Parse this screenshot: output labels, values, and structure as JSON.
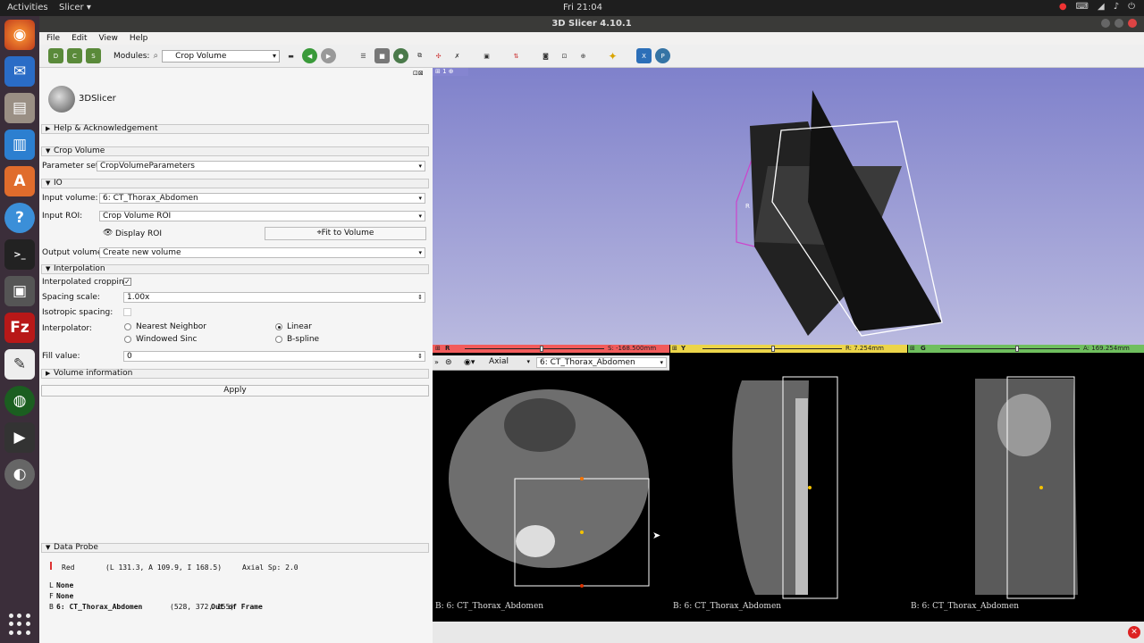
{
  "topbar": {
    "activities": "Activities",
    "app": "Slicer ▾",
    "clock": "Fri 21:04"
  },
  "window_title": "3D Slicer 4.10.1",
  "menu": [
    "File",
    "Edit",
    "View",
    "Help"
  ],
  "toolbar": {
    "modules_label": "Modules:",
    "module_selected": "Crop Volume"
  },
  "logo": "3DSlicer",
  "sections": {
    "help": "Help & Acknowledgement",
    "crop": "Crop Volume",
    "io": "IO",
    "interpolation": "Interpolation",
    "volinfo": "Volume information",
    "probe": "Data Probe"
  },
  "form": {
    "param_label": "Parameter set:",
    "param_value": "CropVolumeParameters",
    "input_vol_label": "Input volume:",
    "input_vol_value": "6: CT_Thorax_Abdomen",
    "input_roi_label": "Input ROI:",
    "input_roi_value": "Crop Volume ROI",
    "display_roi": "Display ROI",
    "fit_button": "Fit to Volume",
    "output_label": "Output volume:",
    "output_value": "Create new volume",
    "interp_crop_label": "Interpolated cropping:",
    "spacing_label": "Spacing scale:",
    "spacing_value": "1.00x",
    "iso_label": "Isotropic spacing:",
    "interpolator_label": "Interpolator:",
    "opt_nn": "Nearest Neighbor",
    "opt_linear": "Linear",
    "opt_ws": "Windowed Sinc",
    "opt_bs": "B-spline",
    "fill_label": "Fill value:",
    "fill_value": "0",
    "apply": "Apply"
  },
  "probe": {
    "red": "Red",
    "coords": "(L 131.3, A 109.9, I 168.5)",
    "axial": "Axial Sp: 2.0",
    "l_prefix": "L",
    "l_value": "None",
    "f_prefix": "F",
    "f_value": "None",
    "b_prefix": "B",
    "b_name": "6: CT_Thorax_Abdomen",
    "b_ijk": "(528, 372, 155)",
    "b_state": "Out of Frame"
  },
  "view3d": {
    "number": "1",
    "roi_label": "R"
  },
  "slices": {
    "red": {
      "letter": "R",
      "offset": "S: -168.500mm",
      "orientation": "Axial",
      "volume": "6: CT_Thorax_Abdomen",
      "caption": "B: 6: CT_Thorax_Abdomen",
      "knob_pos": 0.52
    },
    "yellow": {
      "letter": "Y",
      "offset": "R: 7.254mm",
      "caption": "B: 6: CT_Thorax_Abdomen",
      "knob_pos": 0.45
    },
    "green": {
      "letter": "G",
      "offset": "A: 169.254mm",
      "caption": "B: 6: CT_Thorax_Abdomen",
      "knob_pos": 0.55
    }
  },
  "colors": {
    "red": "#f25b5b",
    "yellow": "#ecd54a",
    "green": "#6fbf5e",
    "roi": "#cc44cc"
  }
}
